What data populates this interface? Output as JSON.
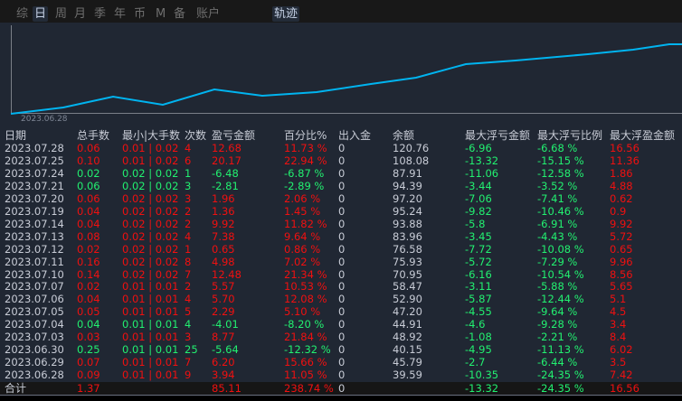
{
  "tabs": [
    "综",
    "日",
    "周",
    "月",
    "季",
    "年",
    "币",
    "M",
    "备",
    "账户"
  ],
  "active_tab": "日",
  "trajectory_button": "轨迹",
  "chart": {
    "start_date": "2023.06.28",
    "line_color": "#00b4f0"
  },
  "columns": [
    "日期",
    "总手数",
    "最小|大手数",
    "次数",
    "盈亏金额",
    "百分比%",
    "出入金",
    "余额",
    "最大浮亏金额",
    "最大浮亏比例",
    "最大浮盈金额"
  ],
  "rows": [
    [
      "2023.07.28",
      "0.06",
      "0.01 | 0.02",
      "4",
      "12.68",
      "11.73 %",
      "0",
      "120.76",
      "-6.96",
      "-6.68 %",
      "16.56",
      "r"
    ],
    [
      "2023.07.25",
      "0.10",
      "0.01 | 0.02",
      "6",
      "20.17",
      "22.94 %",
      "0",
      "108.08",
      "-13.32",
      "-15.15 %",
      "11.36",
      "r"
    ],
    [
      "2023.07.24",
      "0.02",
      "0.02 | 0.02",
      "1",
      "-6.48",
      "-6.87 %",
      "0",
      "87.91",
      "-11.06",
      "-12.58 %",
      "1.86",
      "g"
    ],
    [
      "2023.07.21",
      "0.06",
      "0.02 | 0.02",
      "3",
      "-2.81",
      "-2.89 %",
      "0",
      "94.39",
      "-3.44",
      "-3.52 %",
      "4.88",
      "g"
    ],
    [
      "2023.07.20",
      "0.06",
      "0.02 | 0.02",
      "3",
      "1.96",
      "2.06 %",
      "0",
      "97.20",
      "-7.06",
      "-7.41 %",
      "0.62",
      "r"
    ],
    [
      "2023.07.19",
      "0.04",
      "0.02 | 0.02",
      "2",
      "1.36",
      "1.45 %",
      "0",
      "95.24",
      "-9.82",
      "-10.46 %",
      "0.9",
      "r"
    ],
    [
      "2023.07.14",
      "0.04",
      "0.02 | 0.02",
      "2",
      "9.92",
      "11.82 %",
      "0",
      "93.88",
      "-5.8",
      "-6.91 %",
      "9.92",
      "r"
    ],
    [
      "2023.07.13",
      "0.08",
      "0.02 | 0.02",
      "4",
      "7.38",
      "9.64 %",
      "0",
      "83.96",
      "-3.45",
      "-4.43 %",
      "5.72",
      "r"
    ],
    [
      "2023.07.12",
      "0.02",
      "0.02 | 0.02",
      "1",
      "0.65",
      "0.86 %",
      "0",
      "76.58",
      "-7.72",
      "-10.08 %",
      "0.65",
      "r"
    ],
    [
      "2023.07.11",
      "0.16",
      "0.02 | 0.02",
      "8",
      "4.98",
      "7.02 %",
      "0",
      "75.93",
      "-5.72",
      "-7.29 %",
      "9.96",
      "r"
    ],
    [
      "2023.07.10",
      "0.14",
      "0.02 | 0.02",
      "7",
      "12.48",
      "21.34 %",
      "0",
      "70.95",
      "-6.16",
      "-10.54 %",
      "8.56",
      "r"
    ],
    [
      "2023.07.07",
      "0.02",
      "0.01 | 0.01",
      "2",
      "5.57",
      "10.53 %",
      "0",
      "58.47",
      "-3.11",
      "-5.88 %",
      "5.65",
      "r"
    ],
    [
      "2023.07.06",
      "0.04",
      "0.01 | 0.01",
      "4",
      "5.70",
      "12.08 %",
      "0",
      "52.90",
      "-5.87",
      "-12.44 %",
      "5.1",
      "r"
    ],
    [
      "2023.07.05",
      "0.05",
      "0.01 | 0.01",
      "5",
      "2.29",
      "5.10 %",
      "0",
      "47.20",
      "-4.55",
      "-9.64 %",
      "4.5",
      "r"
    ],
    [
      "2023.07.04",
      "0.04",
      "0.01 | 0.01",
      "4",
      "-4.01",
      "-8.20 %",
      "0",
      "44.91",
      "-4.6",
      "-9.28 %",
      "3.4",
      "g"
    ],
    [
      "2023.07.03",
      "0.03",
      "0.01 | 0.01",
      "3",
      "8.77",
      "21.84 %",
      "0",
      "48.92",
      "-1.08",
      "-2.21 %",
      "8.4",
      "r"
    ],
    [
      "2023.06.30",
      "0.25",
      "0.01 | 0.01",
      "25",
      "-5.64",
      "-12.32 %",
      "0",
      "40.15",
      "-4.95",
      "-11.13 %",
      "6.02",
      "g"
    ],
    [
      "2023.06.29",
      "0.07",
      "0.01 | 0.01",
      "7",
      "6.20",
      "15.66 %",
      "0",
      "45.79",
      "-2.7",
      "-6.44 %",
      "3.5",
      "r"
    ],
    [
      "2023.06.28",
      "0.09",
      "0.01 | 0.01",
      "9",
      "3.94",
      "11.05 %",
      "0",
      "39.59",
      "-10.35",
      "-24.35 %",
      "7.42",
      "r"
    ]
  ],
  "total": [
    "合计",
    "1.37",
    "",
    "",
    "85.11",
    "238.74 %",
    "0",
    "",
    "-13.32",
    "-24.35 %",
    "16.56"
  ]
}
